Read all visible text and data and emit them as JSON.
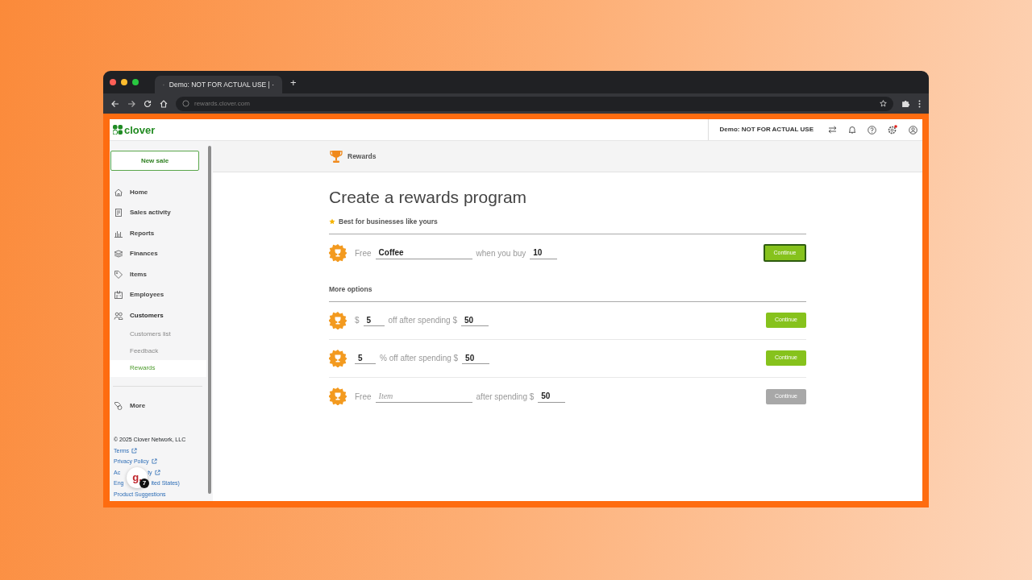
{
  "browser": {
    "tab_title": "Demo: NOT FOR ACTUAL USE | ·",
    "new_tab": "+",
    "url": "rewards.clover.com"
  },
  "header": {
    "logo": "clover",
    "demo_label": "Demo: NOT FOR ACTUAL USE",
    "settings_alert": true
  },
  "sidebar": {
    "new_sale": "New sale",
    "items": [
      {
        "label": "Home",
        "selected": false
      },
      {
        "label": "Sales activity",
        "selected": false
      },
      {
        "label": "Reports",
        "selected": false
      },
      {
        "label": "Finances",
        "selected": false
      },
      {
        "label": "Items",
        "selected": false
      },
      {
        "label": "Employees",
        "selected": false
      },
      {
        "label": "Customers",
        "selected": false,
        "expanded": true,
        "children": [
          {
            "label": "Customers list",
            "selected": false
          },
          {
            "label": "Feedback",
            "selected": false
          },
          {
            "label": "Rewards",
            "selected": true
          }
        ]
      }
    ],
    "more": "More",
    "copyright": "© 2025 Clover Network, LLC",
    "links": [
      {
        "text": "Terms",
        "external": true
      },
      {
        "text": "Privacy Policy",
        "external": true
      },
      {
        "text": "Ac",
        "text_after": "ty",
        "external": true
      },
      {
        "text": "Eng",
        "text_after": "ited States)",
        "external": false
      },
      {
        "text": "Product Suggestions",
        "external": false
      }
    ],
    "overlay_badge": {
      "letter": "g.",
      "count": "7"
    }
  },
  "page": {
    "breadcrumb": "Rewards",
    "title": "Create a rewards program",
    "best_label": "Best for businesses like yours",
    "more_label": "More options",
    "best": [
      {
        "segments": [
          {
            "kind": "text",
            "text": "Free"
          },
          {
            "kind": "item",
            "value": "Coffee"
          },
          {
            "kind": "text",
            "text": "when you buy"
          },
          {
            "kind": "threshold",
            "value": "10"
          }
        ],
        "button": "Continue",
        "focused": true,
        "disabled": false
      }
    ],
    "options": [
      {
        "segments": [
          {
            "kind": "text",
            "text": "$"
          },
          {
            "kind": "discount",
            "value": "5"
          },
          {
            "kind": "text",
            "text": "off after spending $"
          },
          {
            "kind": "threshold",
            "value": "50"
          }
        ],
        "button": "Continue",
        "focused": false,
        "disabled": false
      },
      {
        "segments": [
          {
            "kind": "discount",
            "value": "5"
          },
          {
            "kind": "text",
            "text": "% off after spending $"
          },
          {
            "kind": "threshold",
            "value": "50"
          }
        ],
        "button": "Continue",
        "focused": false,
        "disabled": false
      },
      {
        "segments": [
          {
            "kind": "text",
            "text": "Free"
          },
          {
            "kind": "item",
            "placeholder": "Item"
          },
          {
            "kind": "text",
            "text": "after spending $"
          },
          {
            "kind": "threshold",
            "value": "50"
          }
        ],
        "button": "Continue",
        "focused": false,
        "disabled": true
      }
    ]
  }
}
